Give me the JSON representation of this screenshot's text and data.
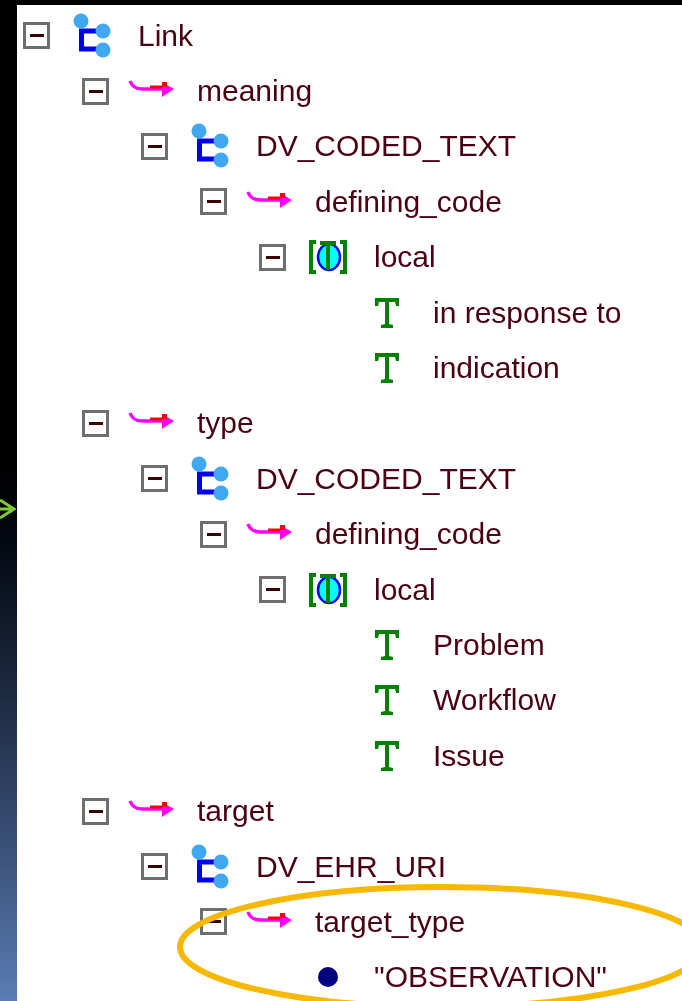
{
  "tree": [
    {
      "label": "Link",
      "kind": "object",
      "expanded": true,
      "children": [
        {
          "label": "meaning",
          "kind": "attribute",
          "expanded": true,
          "children": [
            {
              "label": "DV_CODED_TEXT",
              "kind": "object",
              "expanded": true,
              "children": [
                {
                  "label": "defining_code",
                  "kind": "attribute",
                  "expanded": true,
                  "children": [
                    {
                      "label": "local",
                      "kind": "constraint",
                      "expanded": true,
                      "children": [
                        {
                          "label": "in response to",
                          "kind": "term"
                        },
                        {
                          "label": "indication",
                          "kind": "term"
                        }
                      ]
                    }
                  ]
                }
              ]
            }
          ]
        },
        {
          "label": "type",
          "kind": "attribute",
          "expanded": true,
          "children": [
            {
              "label": "DV_CODED_TEXT",
              "kind": "object",
              "expanded": true,
              "children": [
                {
                  "label": "defining_code",
                  "kind": "attribute",
                  "expanded": true,
                  "children": [
                    {
                      "label": "local",
                      "kind": "constraint",
                      "expanded": true,
                      "children": [
                        {
                          "label": "Problem",
                          "kind": "term"
                        },
                        {
                          "label": "Workflow",
                          "kind": "term"
                        },
                        {
                          "label": "Issue",
                          "kind": "term"
                        }
                      ]
                    }
                  ]
                }
              ]
            }
          ]
        },
        {
          "label": "target",
          "kind": "attribute",
          "expanded": true,
          "children": [
            {
              "label": "DV_EHR_URI",
              "kind": "object",
              "expanded": true,
              "children": [
                {
                  "label": "target_type",
                  "kind": "attribute",
                  "expanded": true,
                  "children": [
                    {
                      "label": "\"OBSERVATION\"",
                      "kind": "value"
                    }
                  ]
                }
              ]
            }
          ]
        }
      ]
    }
  ]
}
